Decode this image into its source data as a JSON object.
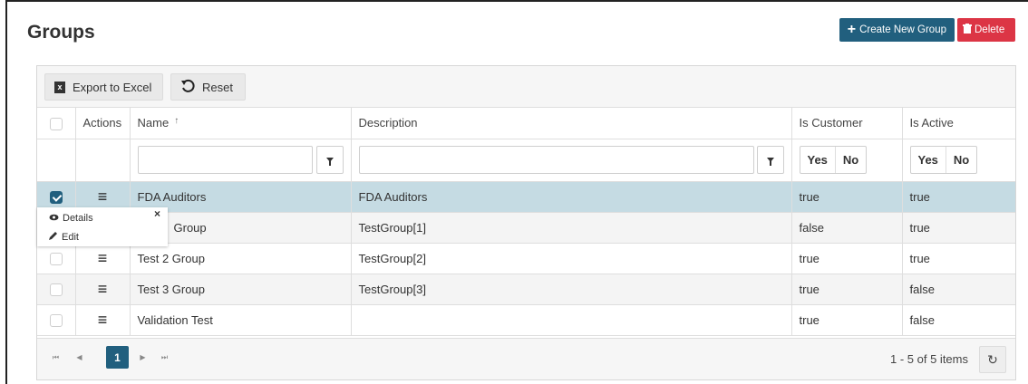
{
  "page": {
    "title": "Groups"
  },
  "header": {
    "create_label": "Create New Group",
    "delete_label": "Delete"
  },
  "toolbar": {
    "excel_label": "Export to Excel",
    "reset_label": "Reset"
  },
  "columns": {
    "actions": "Actions",
    "name": "Name",
    "description": "Description",
    "is_customer": "Is Customer",
    "is_active": "Is Active"
  },
  "filter": {
    "yes": "Yes",
    "no": "No",
    "name_value": "",
    "description_value": ""
  },
  "rows": [
    {
      "name": "FDA Auditors",
      "description": "FDA Auditors",
      "is_customer": "true",
      "is_active": "true",
      "checked": true
    },
    {
      "name": "Group",
      "description": "TestGroup[1]",
      "is_customer": "false",
      "is_active": "true",
      "checked": false
    },
    {
      "name": "Test 2 Group",
      "description": "TestGroup[2]",
      "is_customer": "true",
      "is_active": "true",
      "checked": false
    },
    {
      "name": "Test 3 Group",
      "description": "TestGroup[3]",
      "is_customer": "true",
      "is_active": "false",
      "checked": false
    },
    {
      "name": "Validation Test",
      "description": "",
      "is_customer": "true",
      "is_active": "false",
      "checked": false
    }
  ],
  "context_menu": {
    "details_label": "Details",
    "edit_label": "Edit",
    "close_glyph": "×"
  },
  "pager": {
    "current_page": "1",
    "info": "1 - 5 of 5 items"
  },
  "colors": {
    "primary": "#215f7e",
    "danger": "#dc3545",
    "selected_row": "#c5dbe3"
  }
}
